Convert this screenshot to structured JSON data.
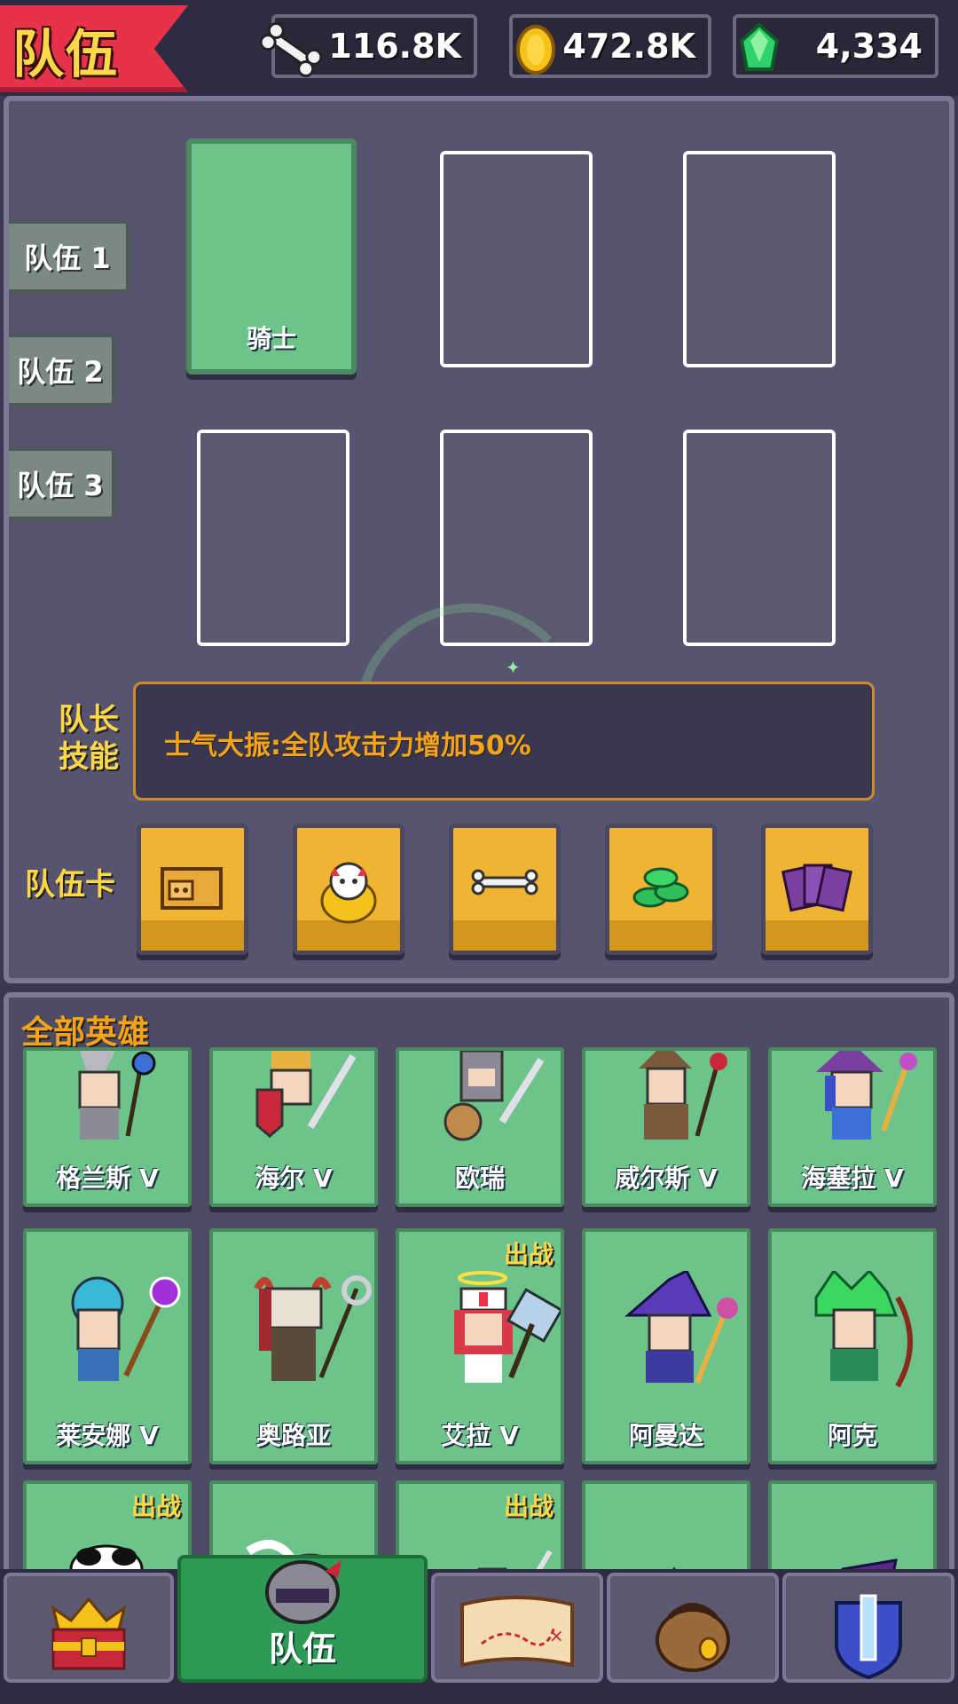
{
  "header": {
    "title": "队伍",
    "resources": [
      {
        "name": "bone",
        "icon": "bone-icon",
        "value": "116.8K"
      },
      {
        "name": "coin",
        "icon": "gold-coin-icon",
        "value": "472.8K"
      },
      {
        "name": "gem",
        "icon": "green-gem-icon",
        "value": "4,334"
      }
    ]
  },
  "team_tabs": [
    "队伍 1",
    "队伍 2",
    "队伍 3"
  ],
  "slots": [
    {
      "name": "骑士"
    },
    {
      "name": ""
    },
    {
      "name": ""
    },
    {
      "name": ""
    },
    {
      "name": ""
    },
    {
      "name": ""
    }
  ],
  "leader_skill": {
    "label_line1": "队长",
    "label_line2": "技能",
    "text": "士气大振:全队攻击力增加50%"
  },
  "team_cards": {
    "label": "队伍卡",
    "cards": [
      "pig-box-icon",
      "lucky-cat-icon",
      "bone-pile-icon",
      "cash-stack-icon",
      "purple-cards-icon"
    ]
  },
  "heroes": {
    "title": "全部英雄",
    "deploy_label": "出战",
    "row1": [
      {
        "name": "格兰斯 Ⅴ",
        "deployed": false
      },
      {
        "name": "海尔 Ⅴ",
        "deployed": false
      },
      {
        "name": "欧瑞",
        "deployed": false
      },
      {
        "name": "威尔斯 Ⅴ",
        "deployed": false
      },
      {
        "name": "海塞拉 Ⅴ",
        "deployed": false
      }
    ],
    "row2": [
      {
        "name": "莱安娜 Ⅴ",
        "deployed": false
      },
      {
        "name": "奥路亚",
        "deployed": false
      },
      {
        "name": "艾拉 Ⅴ",
        "deployed": true
      },
      {
        "name": "阿曼达",
        "deployed": false
      },
      {
        "name": "阿克",
        "deployed": false
      }
    ],
    "row3": [
      {
        "name": "",
        "deployed": true
      },
      {
        "name": "",
        "deployed": false
      },
      {
        "name": "",
        "deployed": true
      },
      {
        "name": "",
        "deployed": false
      },
      {
        "name": "",
        "deployed": false
      }
    ]
  },
  "bottom_nav": [
    {
      "icon": "treasure-chest-icon",
      "label": ""
    },
    {
      "icon": "knight-helmet-icon",
      "label": "队伍",
      "active": true
    },
    {
      "icon": "treasure-map-icon",
      "label": ""
    },
    {
      "icon": "backpack-icon",
      "label": ""
    },
    {
      "icon": "crystal-shield-icon",
      "label": ""
    }
  ]
}
